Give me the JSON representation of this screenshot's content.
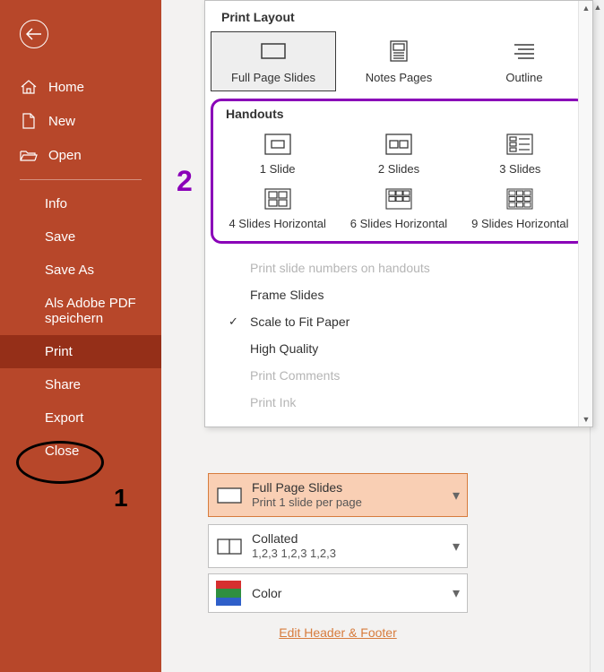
{
  "sidebar": {
    "home": "Home",
    "new": "New",
    "open": "Open",
    "info": "Info",
    "save": "Save",
    "save_as": "Save As",
    "pdf": "Als Adobe PDF speichern",
    "print": "Print",
    "share": "Share",
    "export": "Export",
    "close": "Close"
  },
  "panel": {
    "print_layout_header": "Print Layout",
    "layout": {
      "full_page": "Full Page Slides",
      "notes": "Notes Pages",
      "outline": "Outline"
    },
    "handouts_header": "Handouts",
    "handouts": {
      "s1": "1 Slide",
      "s2": "2 Slides",
      "s3": "3 Slides",
      "h4": "4 Slides Horizontal",
      "h6": "6 Slides Horizontal",
      "h9": "9 Slides Horizontal"
    },
    "menu": {
      "print_nums": "Print slide numbers on handouts",
      "frame": "Frame Slides",
      "fit": "Scale to Fit Paper",
      "hq": "High Quality",
      "comments": "Print Comments",
      "ink": "Print Ink"
    }
  },
  "settings": {
    "fps": {
      "title": "Full Page Slides",
      "sub": "Print 1 slide per page"
    },
    "collated": {
      "title": "Collated",
      "sub": "1,2,3    1,2,3    1,2,3"
    },
    "color": {
      "title": "Color"
    }
  },
  "link": "Edit Header & Footer",
  "annot": {
    "one": "1",
    "two": "2"
  }
}
